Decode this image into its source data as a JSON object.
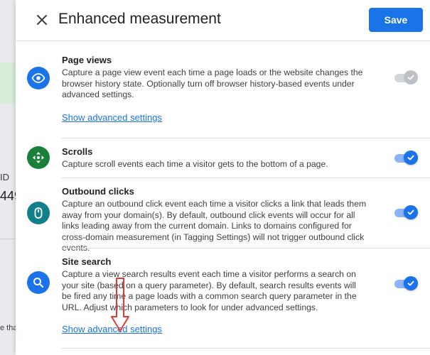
{
  "background": {
    "partial_label": "ID",
    "partial_value": "449",
    "partial_note": "e tha"
  },
  "header": {
    "title": "Enhanced measurement",
    "save_label": "Save"
  },
  "items": [
    {
      "title": "Page views",
      "description": "Capture a page view event each time a page loads or the website changes the browser history state. Optionally turn off browser history-based events under advanced settings.",
      "link": "Show advanced settings",
      "toggle_state": "on-disabled",
      "icon": "eye-icon",
      "icon_color": "#1a73e8"
    },
    {
      "title": "Scrolls",
      "description": "Capture scroll events each time a visitor gets to the bottom of a page.",
      "toggle_state": "on",
      "icon": "move-arrows-icon",
      "icon_color": "#188038"
    },
    {
      "title": "Outbound clicks",
      "description": "Capture an outbound click event each time a visitor clicks a link that leads them away from your domain(s). By default, outbound click events will occur for all links leading away from the current domain. Links to domains configured for cross-domain measurement (in Tagging Settings) will not trigger outbound click events.",
      "toggle_state": "on",
      "icon": "mouse-icon",
      "icon_color": "#12808a"
    },
    {
      "title": "Site search",
      "description": "Capture a view search results event each time a visitor performs a search on your site (based on a query parameter). By default, search results events will be fired any time a page loads with a common search query parameter in the URL. Adjust which parameters to look for under advanced settings.",
      "link": "Show advanced settings",
      "toggle_state": "on",
      "icon": "search-icon",
      "icon_color": "#1a73e8"
    }
  ],
  "colors": {
    "primary": "#1a73e8",
    "annotation_arrow": "#e53935"
  }
}
